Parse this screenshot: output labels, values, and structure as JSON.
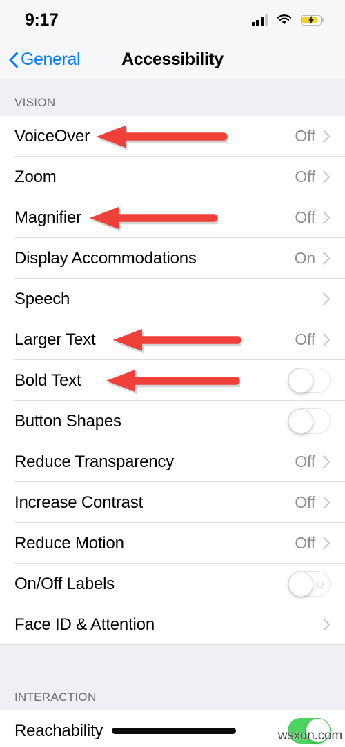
{
  "status_bar": {
    "time": "9:17",
    "signal_icon": "cellular-signal-icon",
    "wifi_icon": "wifi-icon",
    "battery_icon": "battery-charging-icon"
  },
  "nav": {
    "back_label": "General",
    "back_icon": "chevron-left-icon",
    "title": "Accessibility"
  },
  "sections": [
    {
      "header": "VISION",
      "rows": [
        {
          "label": "VoiceOver",
          "value": "Off",
          "control": "disclosure"
        },
        {
          "label": "Zoom",
          "value": "Off",
          "control": "disclosure"
        },
        {
          "label": "Magnifier",
          "value": "Off",
          "control": "disclosure"
        },
        {
          "label": "Display Accommodations",
          "value": "On",
          "control": "disclosure"
        },
        {
          "label": "Speech",
          "value": "",
          "control": "disclosure"
        },
        {
          "label": "Larger Text",
          "value": "Off",
          "control": "disclosure"
        },
        {
          "label": "Bold Text",
          "value": "",
          "control": "toggle",
          "toggle_state": "off"
        },
        {
          "label": "Button Shapes",
          "value": "",
          "control": "toggle",
          "toggle_state": "off"
        },
        {
          "label": "Reduce Transparency",
          "value": "Off",
          "control": "disclosure"
        },
        {
          "label": "Increase Contrast",
          "value": "Off",
          "control": "disclosure"
        },
        {
          "label": "Reduce Motion",
          "value": "Off",
          "control": "disclosure"
        },
        {
          "label": "On/Off Labels",
          "value": "",
          "control": "toggle-labeled",
          "toggle_state": "off"
        },
        {
          "label": "Face ID & Attention",
          "value": "",
          "control": "disclosure"
        }
      ]
    },
    {
      "header": "INTERACTION",
      "rows": [
        {
          "label": "Reachability",
          "value": "",
          "control": "toggle",
          "toggle_state": "on"
        }
      ]
    }
  ],
  "annotations": {
    "arrow_color": "#f0403a",
    "bar_color": "#0b0b0b",
    "arrows": [
      {
        "target": "VoiceOver",
        "direction": "left"
      },
      {
        "target": "Magnifier",
        "direction": "left"
      },
      {
        "target": "Larger Text",
        "direction": "left"
      },
      {
        "target": "Bold Text",
        "direction": "left"
      }
    ],
    "bars": [
      {
        "target": "Reachability"
      }
    ]
  },
  "watermark": "wsxdn.com"
}
